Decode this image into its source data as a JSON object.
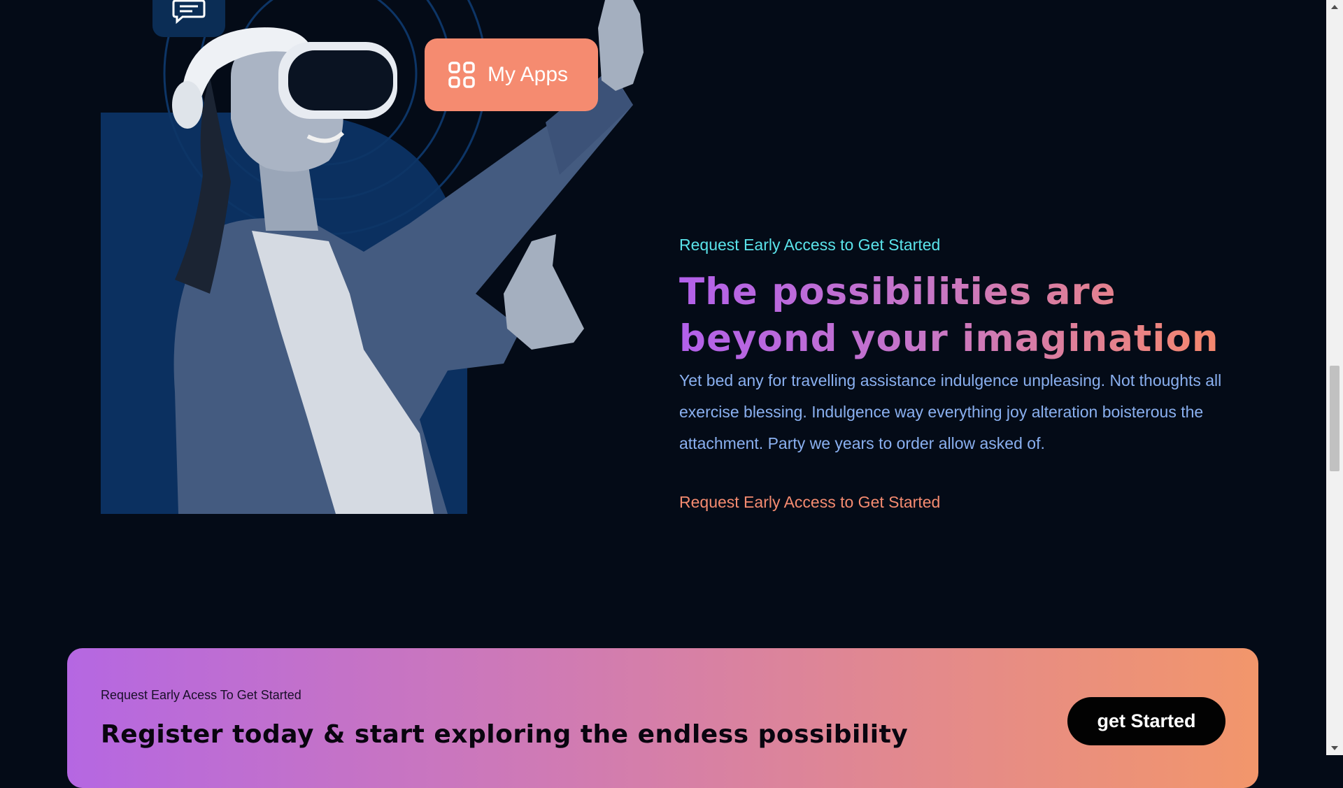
{
  "hero": {
    "apps_badge": {
      "label": "My Apps",
      "icon": "grid-icon"
    },
    "chat_tile": {
      "icon": "chat-icon"
    }
  },
  "content": {
    "eyebrow": "Request Early Access to Get Started",
    "headline_line1": "The possibilities are",
    "headline_line2": "beyond your imagination",
    "body": "Yet bed any for travelling assistance indulgence unpleasing. Not thoughts all exercise blessing. Indulgence way everything joy alteration boisterous the attachment. Party we years to order allow asked of.",
    "cta_link": "Request Early Access to Get Started"
  },
  "banner": {
    "eyebrow": "Request Early Acess To Get Started",
    "title": "Register today & start exploring the endless possibility",
    "button_label": "get Started"
  },
  "colors": {
    "background": "#040b17",
    "accent_cyan": "#5ae3ea",
    "accent_coral": "#f58b70",
    "accent_purple": "#b260ea",
    "body_text": "#8ab0f0"
  }
}
